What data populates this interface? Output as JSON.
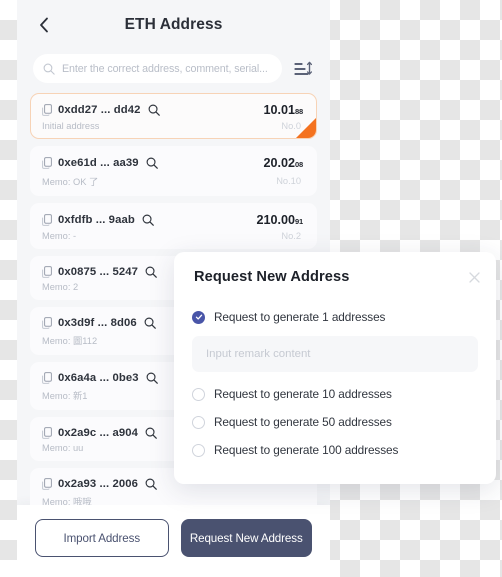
{
  "header": {
    "title": "ETH Address",
    "back_icon": "chevron-left-icon"
  },
  "search": {
    "placeholder": "Enter the correct address, comment, serial...",
    "value": "",
    "search_icon": "search-icon",
    "sort_icon": "sort-icon"
  },
  "list": {
    "items": [
      {
        "address": "0xdd27 ... dd42",
        "memo": "Initial address",
        "amount_int": "10.01",
        "amount_frac": "88",
        "serial": "No.0",
        "highlighted": true
      },
      {
        "address": "0xe61d ... aa39",
        "memo": "Memo: OK 了",
        "amount_int": "20.02",
        "amount_frac": "08",
        "serial": "No.10",
        "highlighted": false
      },
      {
        "address": "0xfdfb ... 9aab",
        "memo": "Memo: -",
        "amount_int": "210.00",
        "amount_frac": "91",
        "serial": "No.2",
        "highlighted": false
      },
      {
        "address": "0x0875 ... 5247",
        "memo": "Memo: 2",
        "amount_int": "",
        "amount_frac": "",
        "serial": "",
        "highlighted": false
      },
      {
        "address": "0x3d9f ... 8d06",
        "memo": "Memo: 圖112",
        "amount_int": "",
        "amount_frac": "",
        "serial": "",
        "highlighted": false
      },
      {
        "address": "0x6a4a ... 0be3",
        "memo": "Memo: 新1",
        "amount_int": "",
        "amount_frac": "",
        "serial": "",
        "highlighted": false
      },
      {
        "address": "0x2a9c ... a904",
        "memo": "Memo: uu",
        "amount_int": "",
        "amount_frac": "",
        "serial": "",
        "highlighted": false
      },
      {
        "address": "0x2a93 ... 2006",
        "memo": "Memo: 哦哦",
        "amount_int": "",
        "amount_frac": "",
        "serial": "",
        "highlighted": false
      }
    ]
  },
  "footer": {
    "import_label": "Import Address",
    "request_label": "Request New Address"
  },
  "dialog": {
    "title": "Request New Address",
    "close_icon": "close-icon",
    "remark_placeholder": "Input remark content",
    "remark_value": "",
    "options": [
      {
        "label": "Request to generate 1 addresses",
        "checked": true
      },
      {
        "label": "Request to generate 10 addresses",
        "checked": false
      },
      {
        "label": "Request to generate 50 addresses",
        "checked": false
      },
      {
        "label": "Request to generate 100 addresses",
        "checked": false
      }
    ]
  },
  "colors": {
    "accent_blue": "#4955a8",
    "button_dark": "#4a5270",
    "flag_orange": "#f4721f",
    "panel_bg": "#f5f6f8"
  }
}
